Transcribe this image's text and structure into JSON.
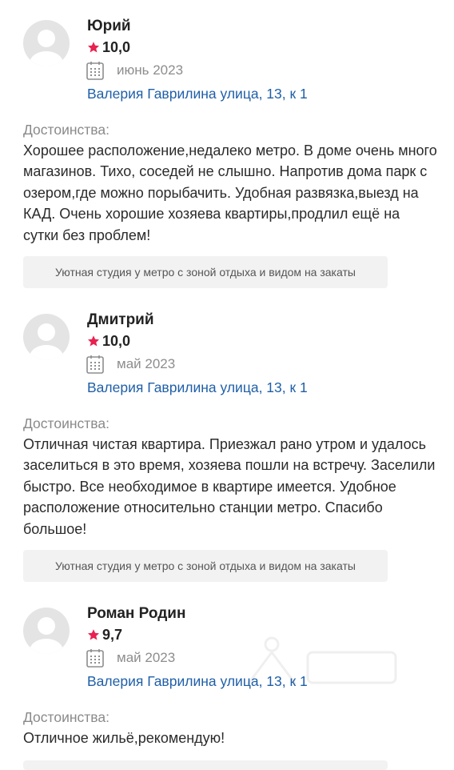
{
  "reviews": [
    {
      "author": "Юрий",
      "rating": "10,0",
      "date": "июнь 2023",
      "address": "Валерия Гаврилина улица, 13, к 1",
      "pros_label": "Достоинства:",
      "pros_text": "Хорошее расположение,недалеко метро. В доме очень много магазинов. Тихо, соседей не слышно. Напротив дома парк с озером,где можно порыбачить. Удобная развязка,выезд на КАД. Очень хорошие хозяева квартиры,продлил ещё на сутки без проблем!",
      "listing": "Уютная студия у метро с зоной отдыха и видом на закаты"
    },
    {
      "author": "Дмитрий",
      "rating": "10,0",
      "date": "май 2023",
      "address": "Валерия Гаврилина улица, 13, к 1",
      "pros_label": "Достоинства:",
      "pros_text": "Отличная чистая квартира. Приезжал рано утром и удалось заселиться в это время, хозяева пошли на встречу. Заселили быстро. Все необходимое в квартире имеется. Удобное расположение относительно станции метро. Спасибо большое!",
      "listing": "Уютная студия у метро с зоной отдыха и видом на закаты"
    },
    {
      "author": "Роман Родин",
      "rating": "9,7",
      "date": "май 2023",
      "address": "Валерия Гаврилина улица, 13, к 1",
      "pros_label": "Достоинства:",
      "pros_text": "Отличное жильё,рекомендую!",
      "listing": ""
    }
  ],
  "colors": {
    "star": "#e8214e",
    "link": "#1f5fa8",
    "muted": "#8d8d8d",
    "tag_bg": "#f2f2f2",
    "avatar_bg": "#e4e4e4"
  },
  "icons": {
    "star": "star-icon",
    "calendar": "calendar-icon",
    "avatar": "user-placeholder-icon"
  }
}
